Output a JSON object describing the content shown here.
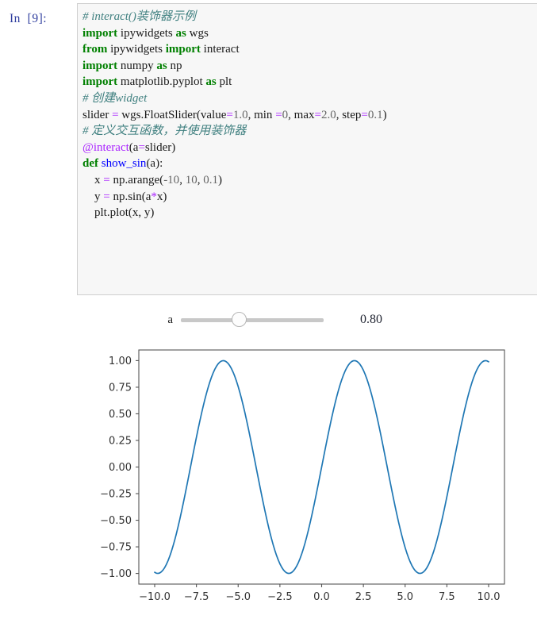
{
  "notebook": {
    "prompt": "In  [9]:",
    "code_lines": [
      [
        {
          "t": "# interact()装饰器示例",
          "c": "cm"
        }
      ],
      [
        {
          "t": "import",
          "c": "k"
        },
        {
          "t": " ipywidgets ",
          "c": "nb"
        },
        {
          "t": "as",
          "c": "k"
        },
        {
          "t": " wgs",
          "c": "nb"
        }
      ],
      [
        {
          "t": "from",
          "c": "k"
        },
        {
          "t": " ipywidgets ",
          "c": "nb"
        },
        {
          "t": "import",
          "c": "k"
        },
        {
          "t": " interact",
          "c": "nb"
        }
      ],
      [
        {
          "t": "import",
          "c": "k"
        },
        {
          "t": " numpy ",
          "c": "nb"
        },
        {
          "t": "as",
          "c": "k"
        },
        {
          "t": " np",
          "c": "nb"
        }
      ],
      [
        {
          "t": "import",
          "c": "k"
        },
        {
          "t": " matplotlib.pyplot ",
          "c": "nb"
        },
        {
          "t": "as",
          "c": "k"
        },
        {
          "t": " plt",
          "c": "nb"
        }
      ],
      [
        {
          "t": "# 创建widget",
          "c": "cm"
        }
      ],
      [
        {
          "t": "slider ",
          "c": "nb"
        },
        {
          "t": "=",
          "c": "op"
        },
        {
          "t": " wgs.FloatSlider(value",
          "c": "nb"
        },
        {
          "t": "=",
          "c": "op"
        },
        {
          "t": "1.0",
          "c": "no"
        },
        {
          "t": ", min ",
          "c": "nb"
        },
        {
          "t": "=",
          "c": "op"
        },
        {
          "t": "0",
          "c": "no"
        },
        {
          "t": ", max",
          "c": "nb"
        },
        {
          "t": "=",
          "c": "op"
        },
        {
          "t": "2.0",
          "c": "no"
        },
        {
          "t": ", step",
          "c": "nb"
        },
        {
          "t": "=",
          "c": "op"
        },
        {
          "t": "0.1",
          "c": "no"
        },
        {
          "t": ")",
          "c": "nb"
        }
      ],
      [
        {
          "t": "# 定义交互函数，并使用装饰器",
          "c": "cm"
        }
      ],
      [
        {
          "t": "@interact",
          "c": "dec"
        },
        {
          "t": "(a",
          "c": "nb"
        },
        {
          "t": "=",
          "c": "op"
        },
        {
          "t": "slider)",
          "c": "nb"
        }
      ],
      [
        {
          "t": "def",
          "c": "k"
        },
        {
          "t": " ",
          "c": "nb"
        },
        {
          "t": "show_sin",
          "c": "fn"
        },
        {
          "t": "(a):",
          "c": "nb"
        }
      ],
      [
        {
          "t": "    x ",
          "c": "nb"
        },
        {
          "t": "=",
          "c": "op"
        },
        {
          "t": " np.arange(",
          "c": "nb"
        },
        {
          "t": "-10",
          "c": "no"
        },
        {
          "t": ", ",
          "c": "nb"
        },
        {
          "t": "10",
          "c": "no"
        },
        {
          "t": ", ",
          "c": "nb"
        },
        {
          "t": "0.1",
          "c": "no"
        },
        {
          "t": ")",
          "c": "nb"
        }
      ],
      [
        {
          "t": "    y ",
          "c": "nb"
        },
        {
          "t": "=",
          "c": "op"
        },
        {
          "t": " np.sin(a",
          "c": "nb"
        },
        {
          "t": "*",
          "c": "op"
        },
        {
          "t": "x)",
          "c": "nb"
        }
      ],
      [
        {
          "t": "    plt.plot(x, y)",
          "c": "nb"
        }
      ]
    ]
  },
  "widget": {
    "label": "a",
    "value_text": "0.80",
    "value": 0.8,
    "min": 0,
    "max": 2.0,
    "step": 0.1,
    "track_color": "#c8c8c8",
    "handle_color": "#fdfdfd"
  },
  "chart_data": {
    "type": "line",
    "title": "",
    "xlabel": "",
    "ylabel": "",
    "xlim": [
      -10.95,
      10.95
    ],
    "ylim": [
      -1.1,
      1.1
    ],
    "grid": false,
    "legend": null,
    "line_color": "#1f77b4",
    "line_width": 1.7,
    "xticks": [
      -10.0,
      -7.5,
      -5.0,
      -2.5,
      0.0,
      2.5,
      5.0,
      7.5,
      10.0
    ],
    "xtick_labels": [
      "−10.0",
      "−7.5",
      "−5.0",
      "−2.5",
      "0.0",
      "2.5",
      "5.0",
      "7.5",
      "10.0"
    ],
    "yticks": [
      -1.0,
      -0.75,
      -0.5,
      -0.25,
      0.0,
      0.25,
      0.5,
      0.75,
      1.0
    ],
    "ytick_labels": [
      "−1.00",
      "−0.75",
      "−0.50",
      "−0.25",
      "0.00",
      "0.25",
      "0.50",
      "0.75",
      "1.00"
    ],
    "series": [
      {
        "name": "sin(0.8*x)",
        "function": "sin",
        "amplitude": 1.0,
        "frequency": 0.8,
        "x_start": -10,
        "x_end": 10,
        "x_step": 0.1
      }
    ]
  }
}
